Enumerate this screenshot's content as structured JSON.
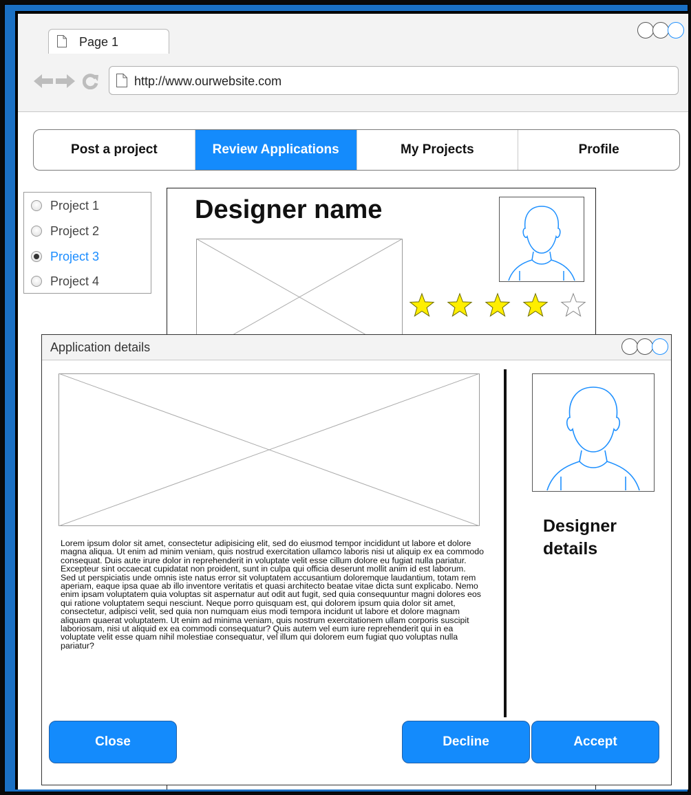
{
  "browser": {
    "tab_title": "Page 1",
    "url": "http://www.ourwebsite.com",
    "icons": {
      "tab": "document-icon",
      "back": "back-arrow-icon",
      "forward": "forward-arrow-icon",
      "refresh": "refresh-icon",
      "url": "document-icon"
    }
  },
  "main_nav": {
    "items": [
      {
        "label": "Post a project",
        "active": false
      },
      {
        "label": "Review Applications",
        "active": true
      },
      {
        "label": "My Projects",
        "active": false
      },
      {
        "label": "Profile",
        "active": false
      }
    ]
  },
  "projects": {
    "items": [
      {
        "label": "Project 1",
        "selected": false
      },
      {
        "label": "Project 2",
        "selected": false
      },
      {
        "label": "Project 3",
        "selected": true
      },
      {
        "label": "Project 4",
        "selected": false
      }
    ]
  },
  "designer_card": {
    "name": "Designer name",
    "rating": 4,
    "rating_max": 5
  },
  "modal": {
    "title": "Application details",
    "body_paragraphs": [
      "Lorem ipsum dolor sit amet, consectetur adipisicing elit, sed do eiusmod tempor incididunt ut labore et dolore magna aliqua. Ut enim ad minim veniam, quis nostrud exercitation ullamco laboris nisi ut aliquip ex ea commodo consequat. Duis aute irure dolor in reprehenderit in voluptate velit esse cillum dolore eu fugiat nulla pariatur. Excepteur sint occaecat cupidatat non proident, sunt in culpa qui officia deserunt mollit anim id est laborum.",
      "Sed ut perspiciatis unde omnis iste natus error sit voluptatem accusantium doloremque laudantium, totam rem aperiam, eaque ipsa quae ab illo inventore veritatis et quasi architecto beatae vitae dicta sunt explicabo. Nemo enim ipsam voluptatem quia voluptas sit aspernatur aut odit aut fugit, sed quia consequuntur magni dolores eos qui ratione voluptatem sequi nesciunt. Neque porro quisquam est, qui dolorem ipsum quia dolor sit amet, consectetur, adipisci velit, sed quia non numquam eius modi tempora incidunt ut labore et dolore magnam aliquam quaerat voluptatem. Ut enim ad minima veniam, quis nostrum exercitationem ullam corporis suscipit laboriosam, nisi ut aliquid ex ea commodi consequatur? Quis autem vel eum iure reprehenderit qui in ea voluptate velit esse quam nihil molestiae consequatur, vel illum qui dolorem eum fugiat quo voluptas nulla pariatur?"
    ],
    "designer_details_label": "Designer details",
    "buttons": {
      "close": "Close",
      "decline": "Decline",
      "accept": "Accept"
    }
  },
  "colors": {
    "accent": "#148bfc",
    "frame": "#1a70c4",
    "star_fill": "#ffee00",
    "avatar_stroke": "#1e90ff"
  }
}
